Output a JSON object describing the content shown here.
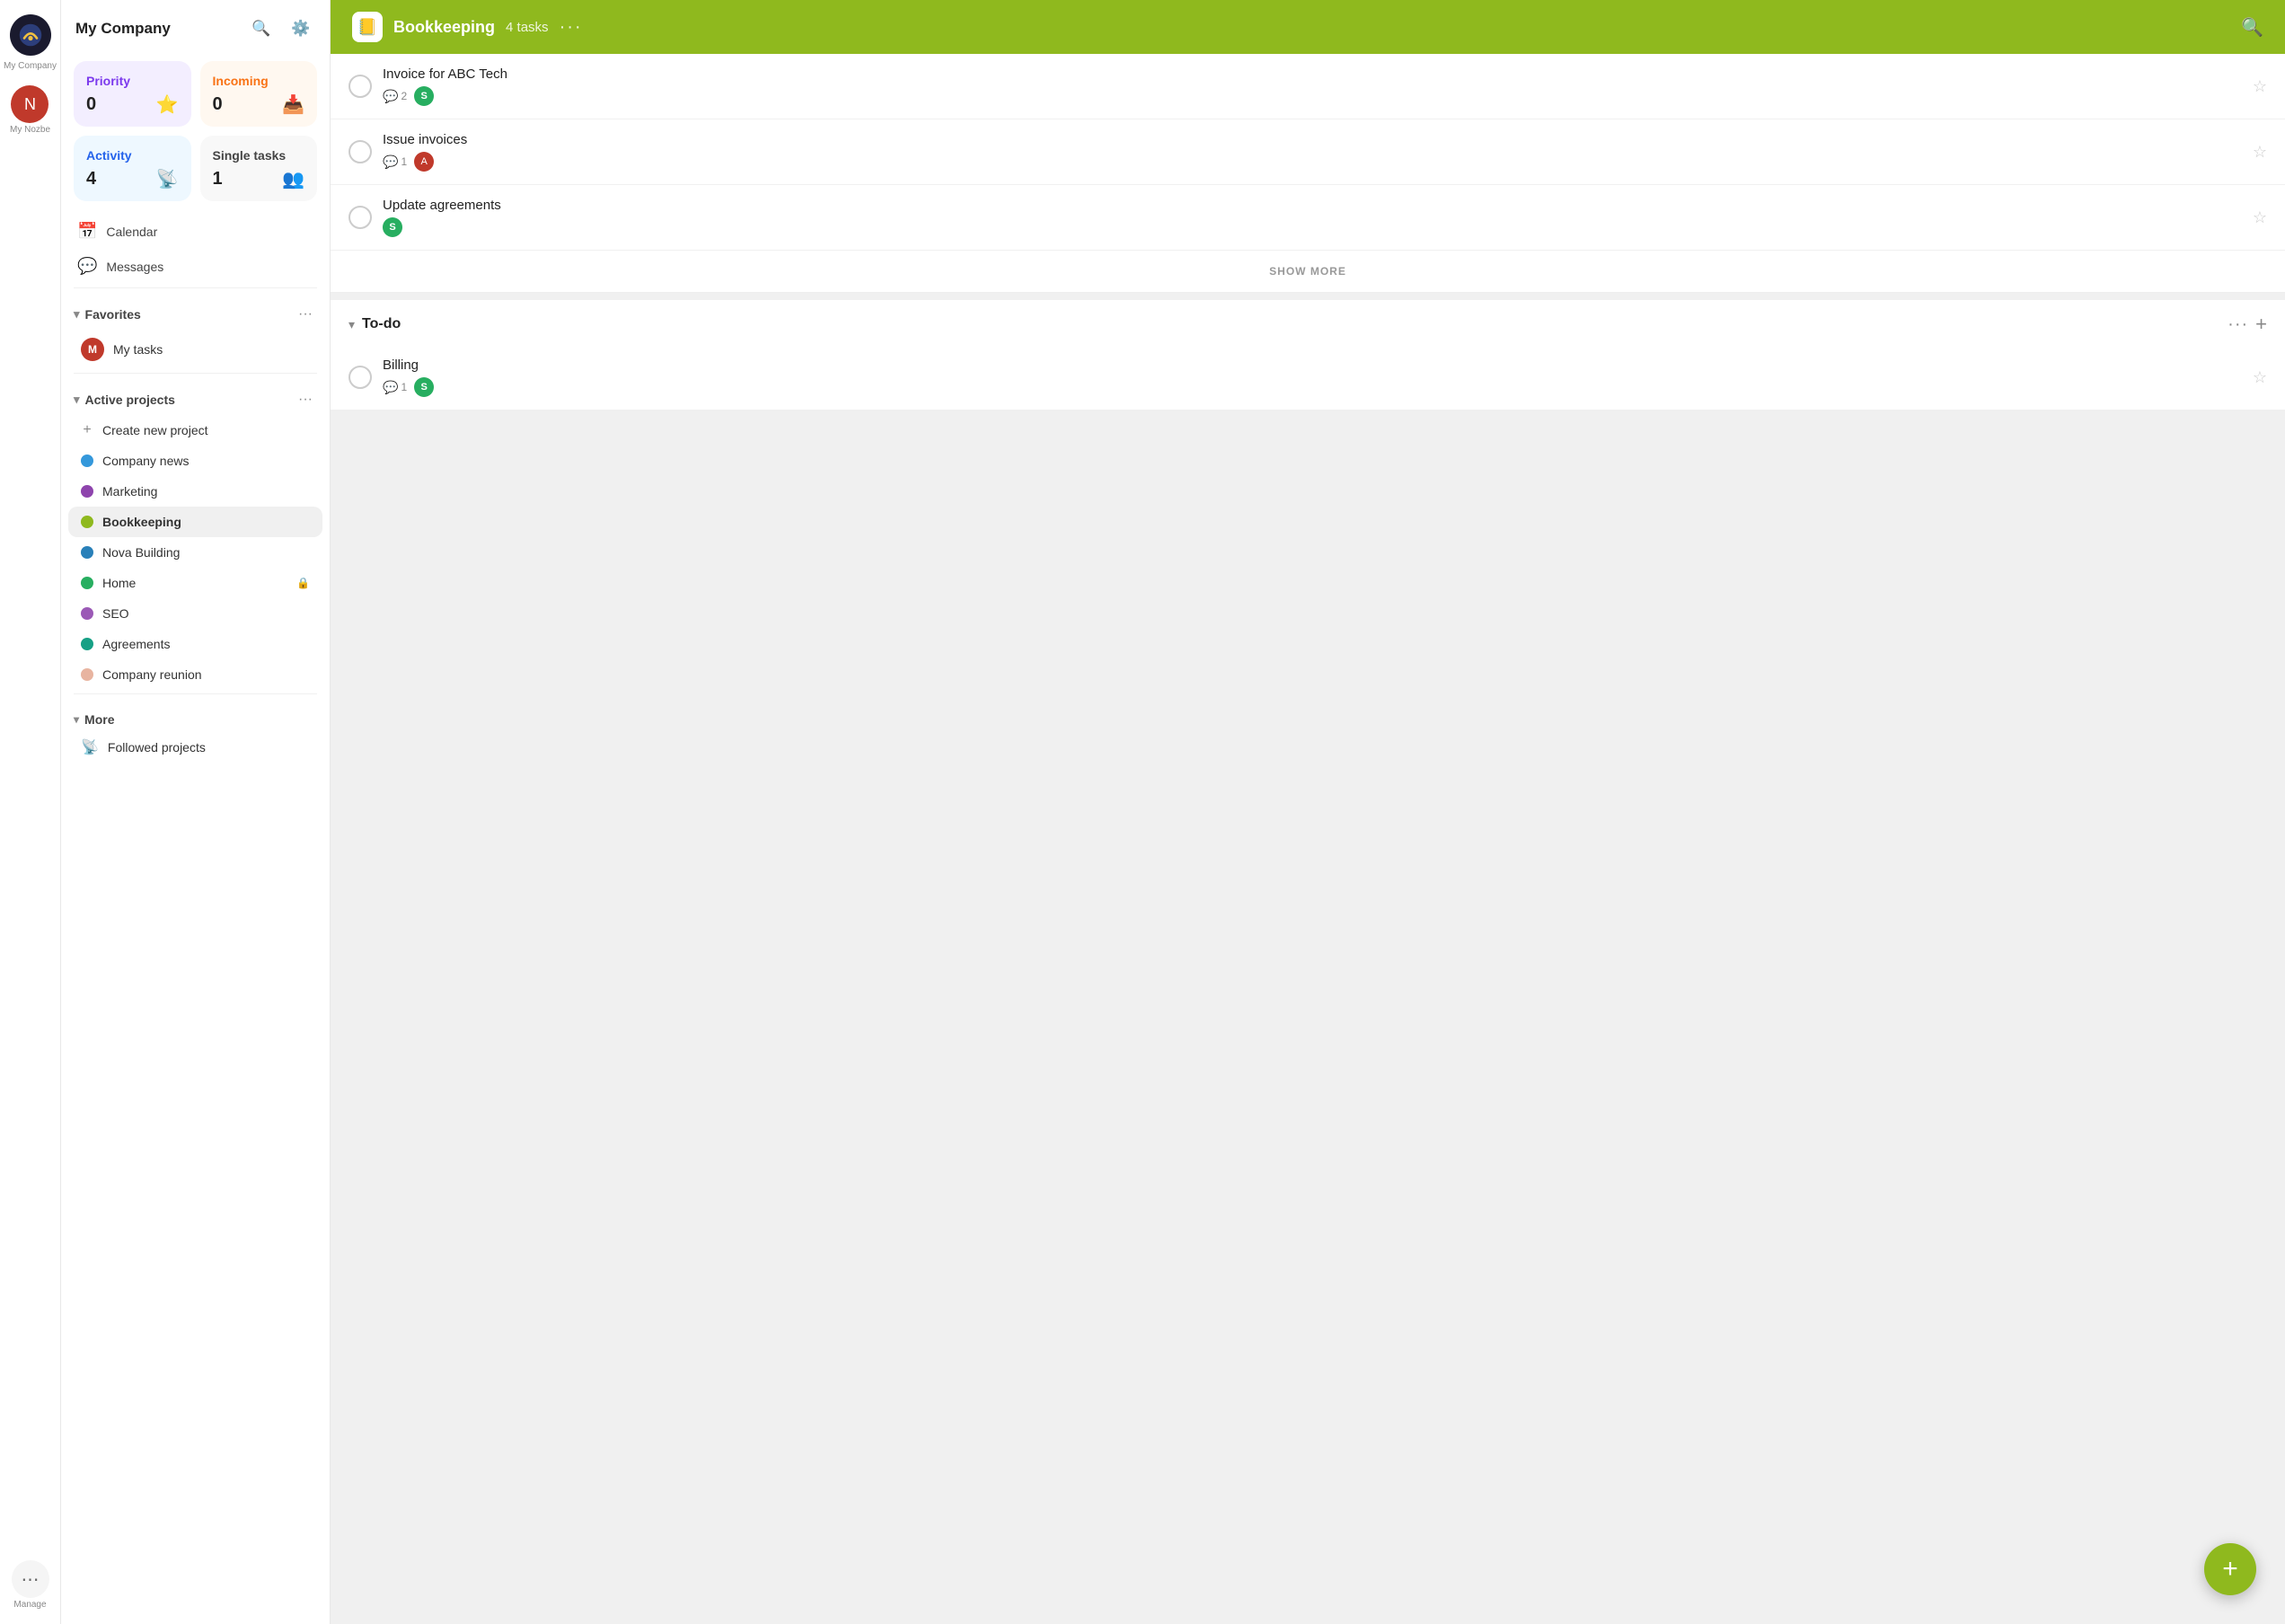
{
  "app": {
    "company_name": "My Company",
    "workspace_label": "My Company"
  },
  "rail": {
    "avatar_initial": "N",
    "manage_label": "Manage",
    "my_nozbe_label": "My Nozbe"
  },
  "sidebar": {
    "search_icon": "🔍",
    "settings_icon": "⚙️",
    "title": "My Company",
    "cards": {
      "priority": {
        "label": "Priority",
        "count": "0",
        "icon": "⭐"
      },
      "incoming": {
        "label": "Incoming",
        "count": "0",
        "icon": "📥"
      },
      "activity": {
        "label": "Activity",
        "count": "4",
        "icon": "📡"
      },
      "single": {
        "label": "Single tasks",
        "count": "1",
        "icon": "👥"
      }
    },
    "nav_items": [
      {
        "icon": "📅",
        "label": "Calendar"
      },
      {
        "icon": "💬",
        "label": "Messages"
      }
    ],
    "favorites": {
      "label": "Favorites",
      "items": [
        {
          "label": "My tasks",
          "has_avatar": true
        }
      ]
    },
    "active_projects": {
      "label": "Active projects",
      "items": [
        {
          "label": "Create new project",
          "dot_color": "#aaa",
          "is_add": true
        },
        {
          "label": "Company news",
          "dot_color": "#3498db"
        },
        {
          "label": "Marketing",
          "dot_color": "#8e44ad"
        },
        {
          "label": "Bookkeeping",
          "dot_color": "#8fb91e",
          "active": true
        },
        {
          "label": "Nova Building",
          "dot_color": "#2980b9"
        },
        {
          "label": "Home",
          "dot_color": "#27ae60",
          "has_lock": true
        },
        {
          "label": "SEO",
          "dot_color": "#9b59b6"
        },
        {
          "label": "Agreements",
          "dot_color": "#16a085"
        },
        {
          "label": "Company reunion",
          "dot_color": "#e8b4a0"
        }
      ]
    },
    "more": {
      "label": "More",
      "items": [
        {
          "icon": "📡",
          "label": "Followed projects"
        }
      ]
    }
  },
  "main": {
    "header": {
      "app_icon": "📒",
      "title": "Bookkeeping",
      "task_count": "4 tasks",
      "dots_label": "···",
      "search_icon": "🔍"
    },
    "tasks_section": {
      "tasks": [
        {
          "name": "Invoice for ABC Tech",
          "comment_count": "2",
          "has_avatar": true,
          "avatar_type": "green",
          "avatar_label": "S"
        },
        {
          "name": "Issue invoices",
          "comment_count": "1",
          "has_avatar": true,
          "avatar_type": "photo",
          "avatar_label": "A"
        },
        {
          "name": "Update agreements",
          "comment_count": null,
          "has_avatar": true,
          "avatar_type": "green",
          "avatar_label": "S"
        }
      ],
      "show_more_label": "SHOW MORE"
    },
    "todo_section": {
      "title": "To-do",
      "tasks": [
        {
          "name": "Billing",
          "comment_count": "1",
          "has_avatar": true,
          "avatar_type": "green",
          "avatar_label": "S"
        }
      ]
    }
  },
  "fab": {
    "icon": "+"
  }
}
